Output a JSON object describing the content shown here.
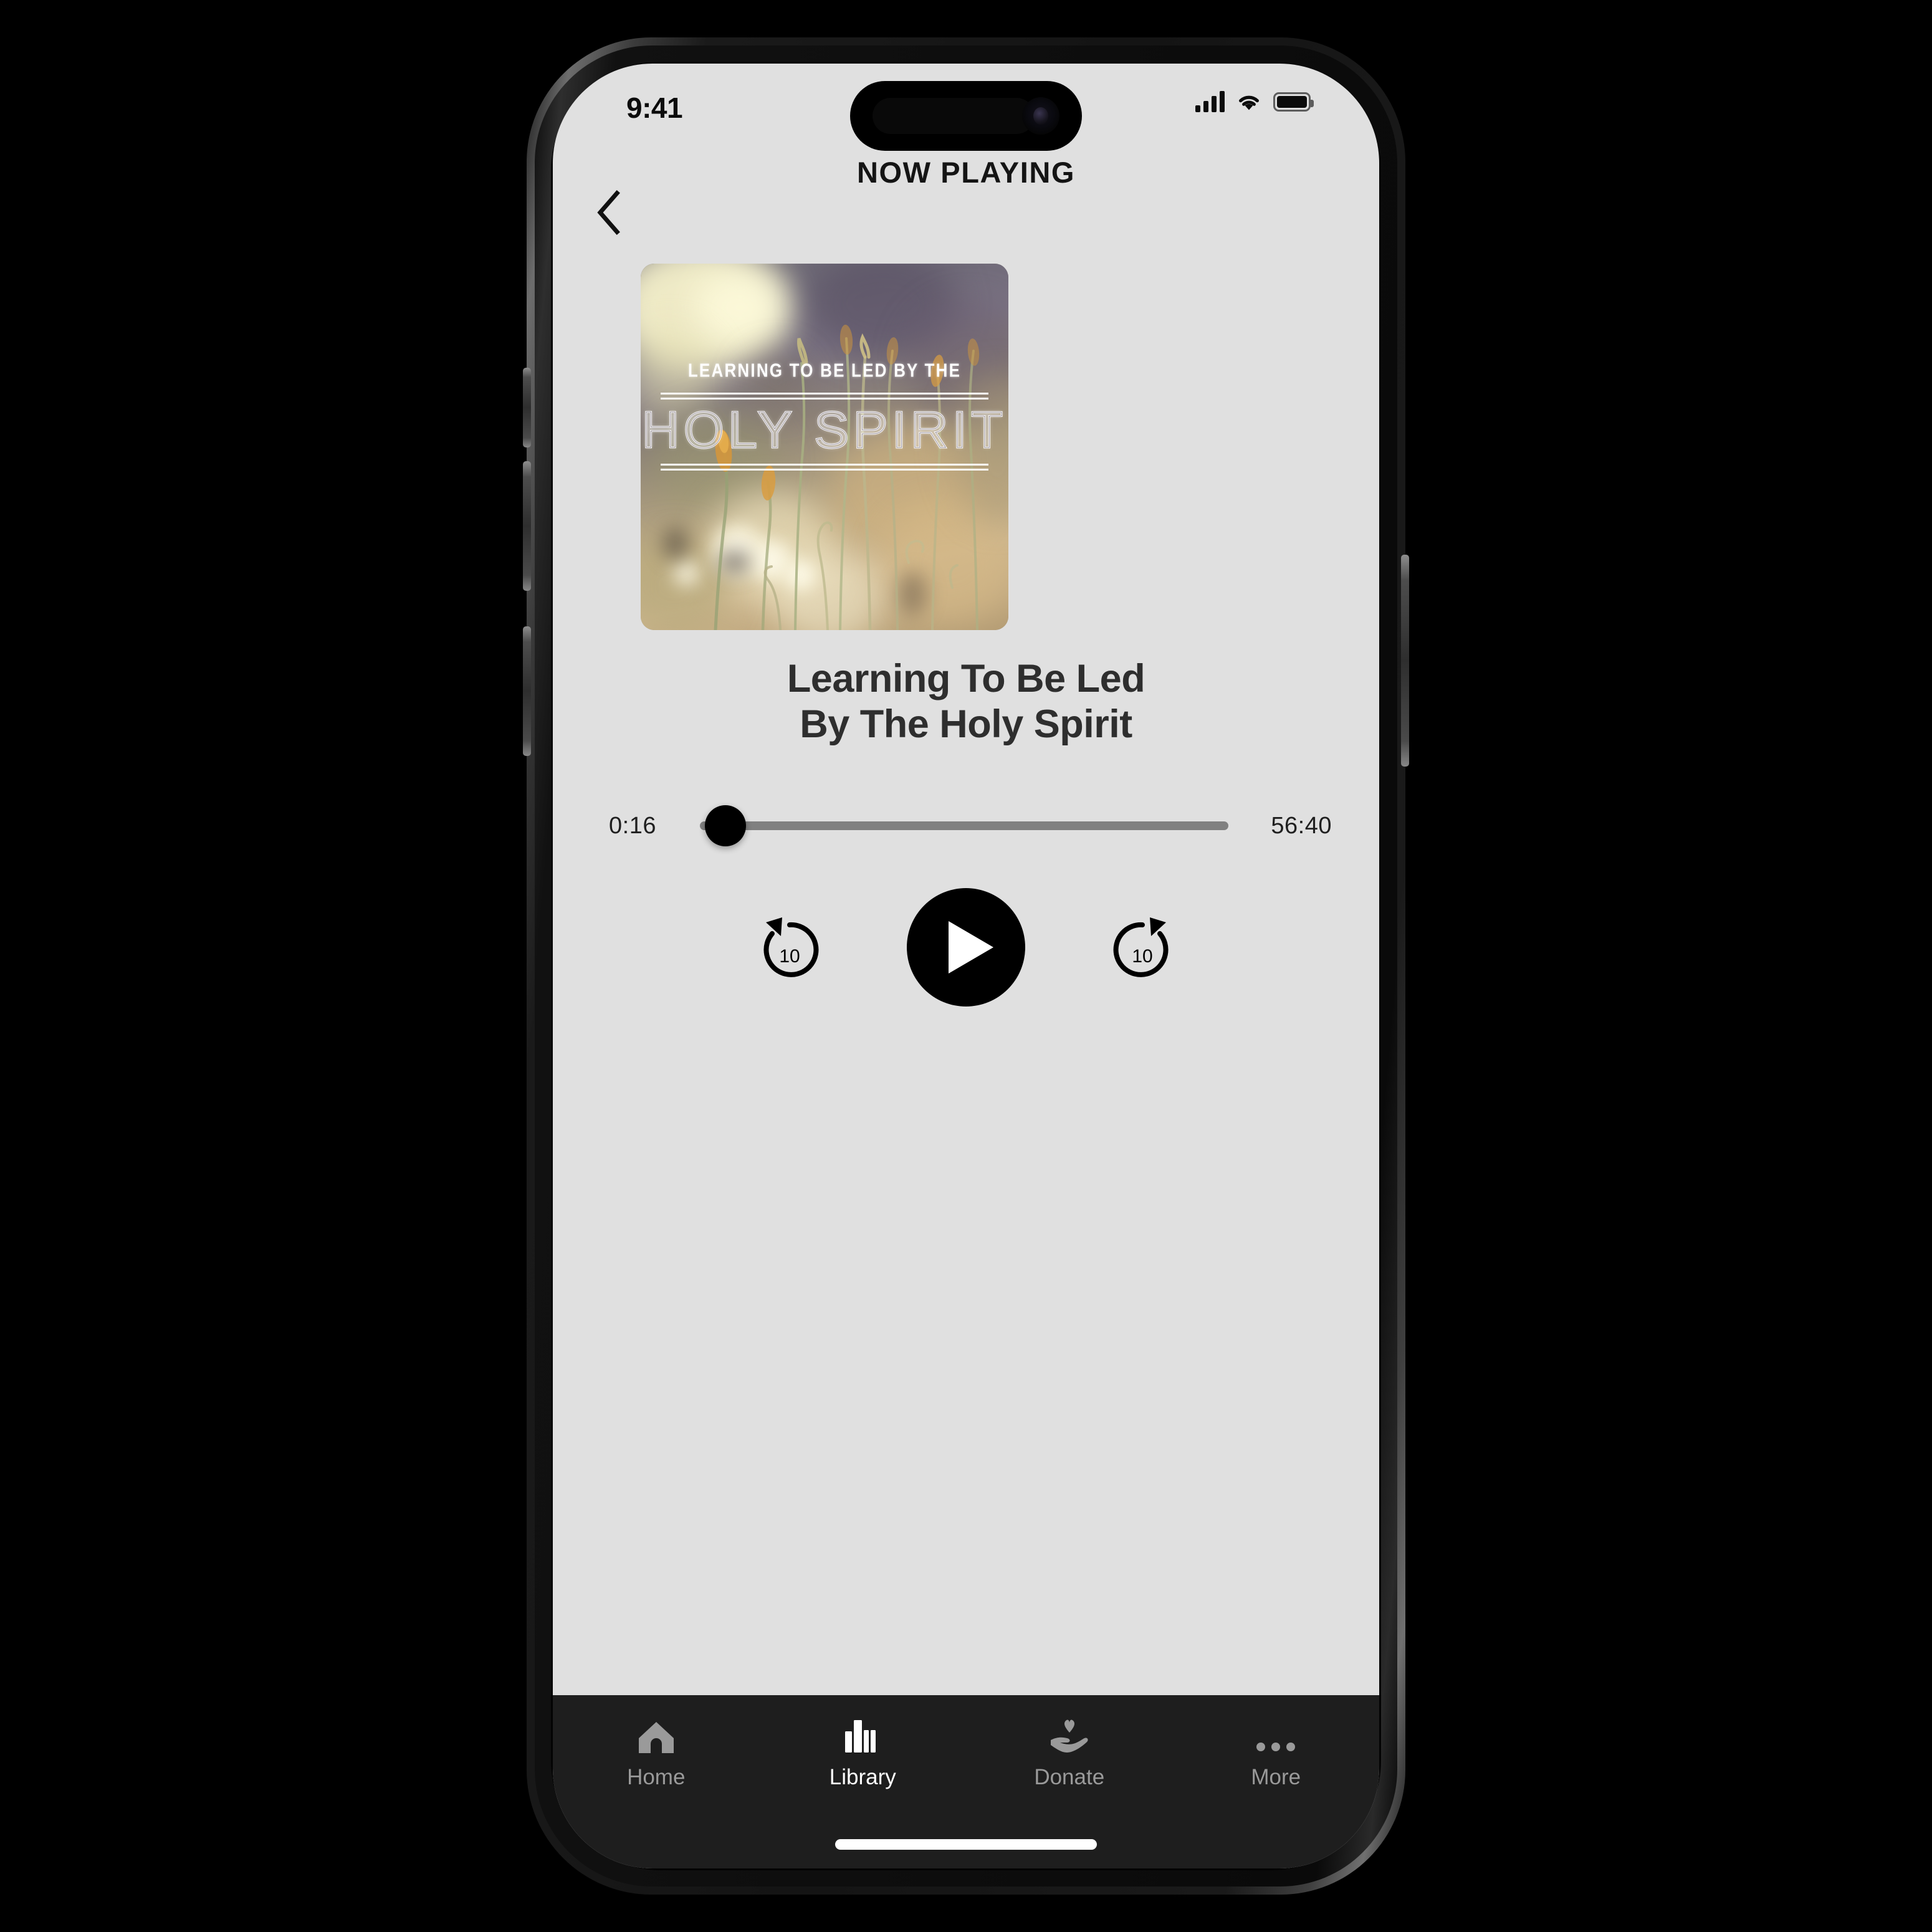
{
  "status_bar": {
    "time": "9:41",
    "signal_icon": "cellular-signal-icon",
    "wifi_icon": "wifi-icon",
    "battery_icon": "battery-full-icon"
  },
  "nav": {
    "title": "NOW PLAYING",
    "back_icon": "chevron-left-icon"
  },
  "artwork": {
    "kicker": "LEARNING TO BE LED BY THE",
    "main": "HOLY SPIRIT",
    "description": "Backlit golden meadow with dandelion seed heads and wildflower stems, blurred purple-gray and warm tan bokeh background"
  },
  "episode": {
    "title_line1": "Learning To Be Led",
    "title_line2": "By The Holy Spirit"
  },
  "player": {
    "current_time": "0:16",
    "total_time": "56:40",
    "progress_percent": 1,
    "skip_back_label": "10",
    "skip_forward_label": "10",
    "skip_back_icon": "rewind-10-icon",
    "skip_forward_icon": "forward-10-icon",
    "play_icon": "play-icon",
    "slider_thumb": "progress-thumb"
  },
  "tabs": [
    {
      "label": "Home",
      "icon": "home-icon",
      "active": false
    },
    {
      "label": "Library",
      "icon": "library-icon",
      "active": true
    },
    {
      "label": "Donate",
      "icon": "donate-hand-heart-icon",
      "active": false
    },
    {
      "label": "More",
      "icon": "ellipsis-icon",
      "active": false
    }
  ],
  "colors": {
    "screen_bg": "#e0e0e0",
    "tabbar_bg": "#1e1e1e",
    "text_primary": "#2e2e2e",
    "accent": "#000000",
    "track": "#808080",
    "tab_inactive": "#9a9a9a",
    "tab_active": "#ffffff"
  }
}
